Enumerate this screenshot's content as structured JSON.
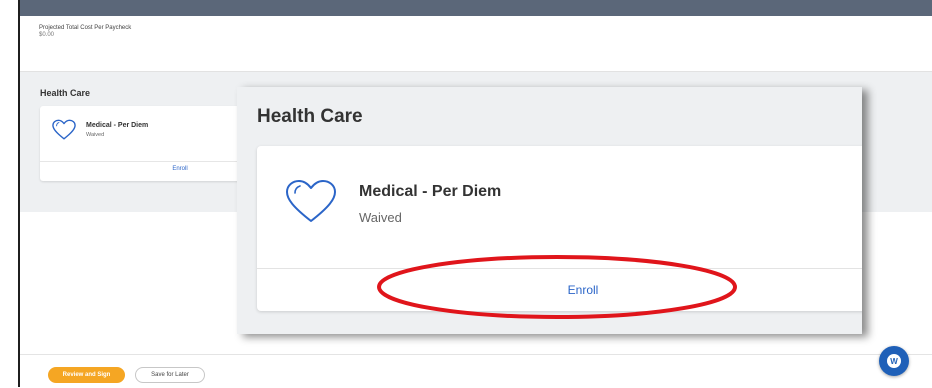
{
  "header": {
    "cost_label": "Projected Total Cost Per Paycheck",
    "cost_value": "$0.00"
  },
  "health_care": {
    "title": "Health Care",
    "plan_name": "Medical - Per Diem",
    "plan_status": "Waived",
    "enroll_label": "Enroll"
  },
  "zoom": {
    "title": "Health Care",
    "plan_name": "Medical - Per Diem",
    "plan_status": "Waived",
    "enroll_label": "Enroll"
  },
  "footer": {
    "review_label": "Review and Sign",
    "save_label": "Save for Later"
  },
  "help": {
    "glyph": "W"
  },
  "colors": {
    "accent_blue": "#2b65c8",
    "review_orange": "#f5a623",
    "highlight_red": "#e0151b",
    "topbar": "#5b6779"
  },
  "icons": [
    "heart-icon",
    "help-chat-icon"
  ]
}
